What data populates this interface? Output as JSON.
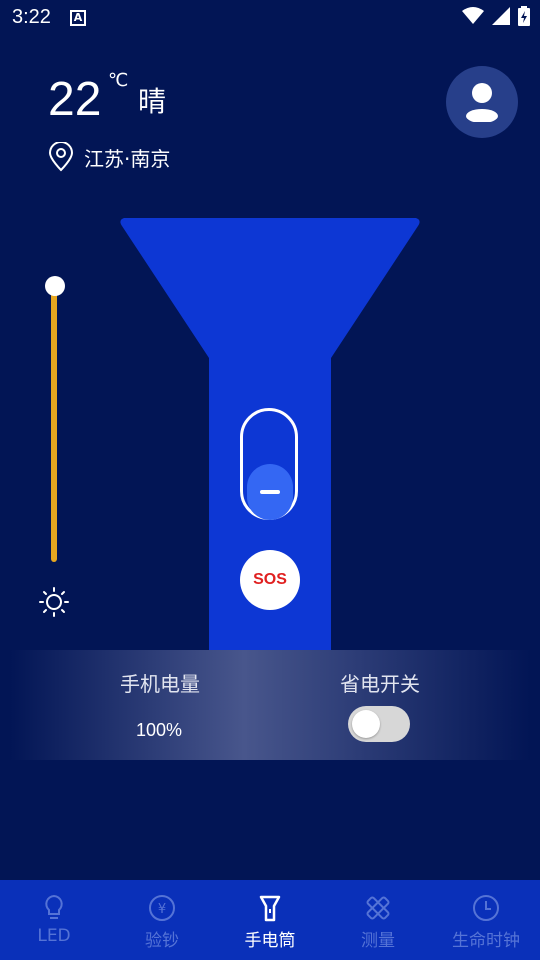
{
  "status_bar": {
    "time": "3:22",
    "a_icon": "A"
  },
  "weather": {
    "temperature": "22",
    "unit": "℃",
    "condition": "晴",
    "location": "江苏·南京"
  },
  "brightness": {
    "level": 1.0
  },
  "flashlight": {
    "sos_label": "SOS",
    "switch_state": "off"
  },
  "info": {
    "battery_label": "手机电量",
    "battery_value": "100%",
    "saver_label": "省电开关",
    "saver_on": false
  },
  "nav": {
    "items": [
      {
        "label": "LED",
        "icon": "bulb-icon"
      },
      {
        "label": "验钞",
        "icon": "yen-icon"
      },
      {
        "label": "手电筒",
        "icon": "flashlight-icon",
        "active": true
      },
      {
        "label": "测量",
        "icon": "ruler-icon"
      },
      {
        "label": "生命时钟",
        "icon": "clock-icon"
      }
    ]
  },
  "colors": {
    "background": "#021555",
    "accent": "#e6a720",
    "flash": "#0d37d4",
    "nav": "#0a30b9"
  }
}
